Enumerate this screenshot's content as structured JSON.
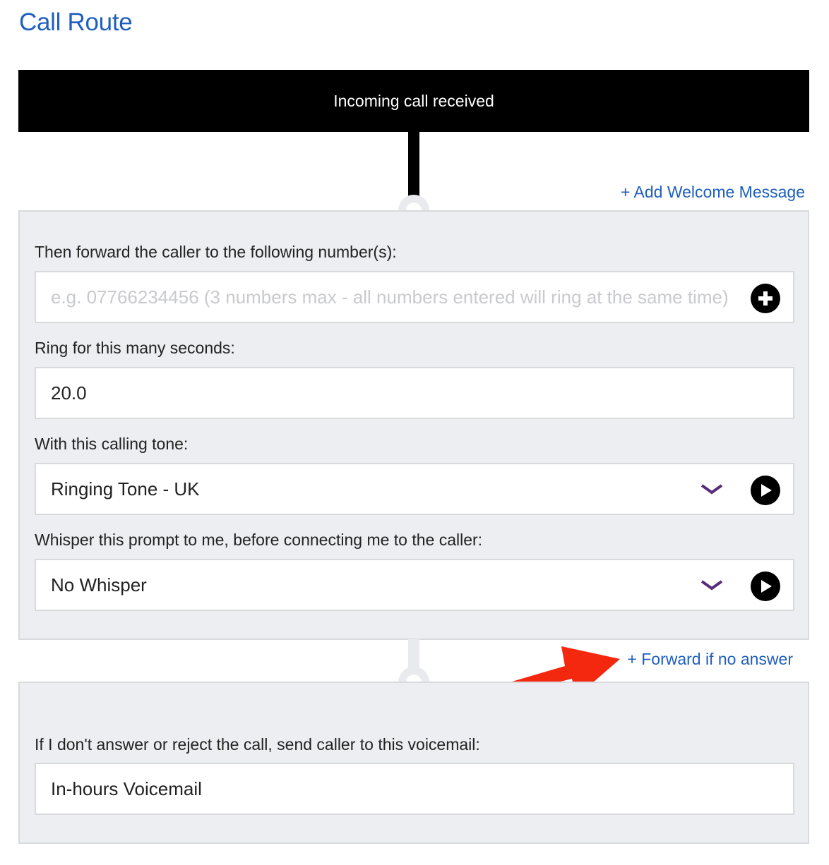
{
  "page": {
    "title": "Call Route"
  },
  "flow": {
    "start_label": "Incoming call received",
    "add_welcome_label": "+ Add Welcome Message",
    "forward_if_no_answer_label": "+ Forward if no answer"
  },
  "forward_panel": {
    "numbers": {
      "label": "Then forward the caller to the following number(s):",
      "value": "",
      "placeholder": "e.g. 07766234456 (3 numbers max - all numbers entered will ring at the same time)",
      "add_icon": "plus-circle-icon"
    },
    "ring_seconds": {
      "label": "Ring for this many seconds:",
      "value": "20.0"
    },
    "calling_tone": {
      "label": "With this calling tone:",
      "selected": "Ringing Tone - UK",
      "dropdown_icon": "chevron-down-icon",
      "play_icon": "play-icon"
    },
    "whisper": {
      "label": "Whisper this prompt to me, before connecting me to the caller:",
      "selected": "No Whisper",
      "dropdown_icon": "chevron-down-icon",
      "play_icon": "play-icon"
    }
  },
  "voicemail_panel": {
    "label": "If I don't answer or reject the call, send caller to this voicemail:",
    "selected": "In-hours Voicemail"
  },
  "colors": {
    "link": "#1f5fbf",
    "chevron": "#5a2a7a",
    "annotation_arrow": "#f4280f",
    "panel_bg": "#eceef1"
  }
}
